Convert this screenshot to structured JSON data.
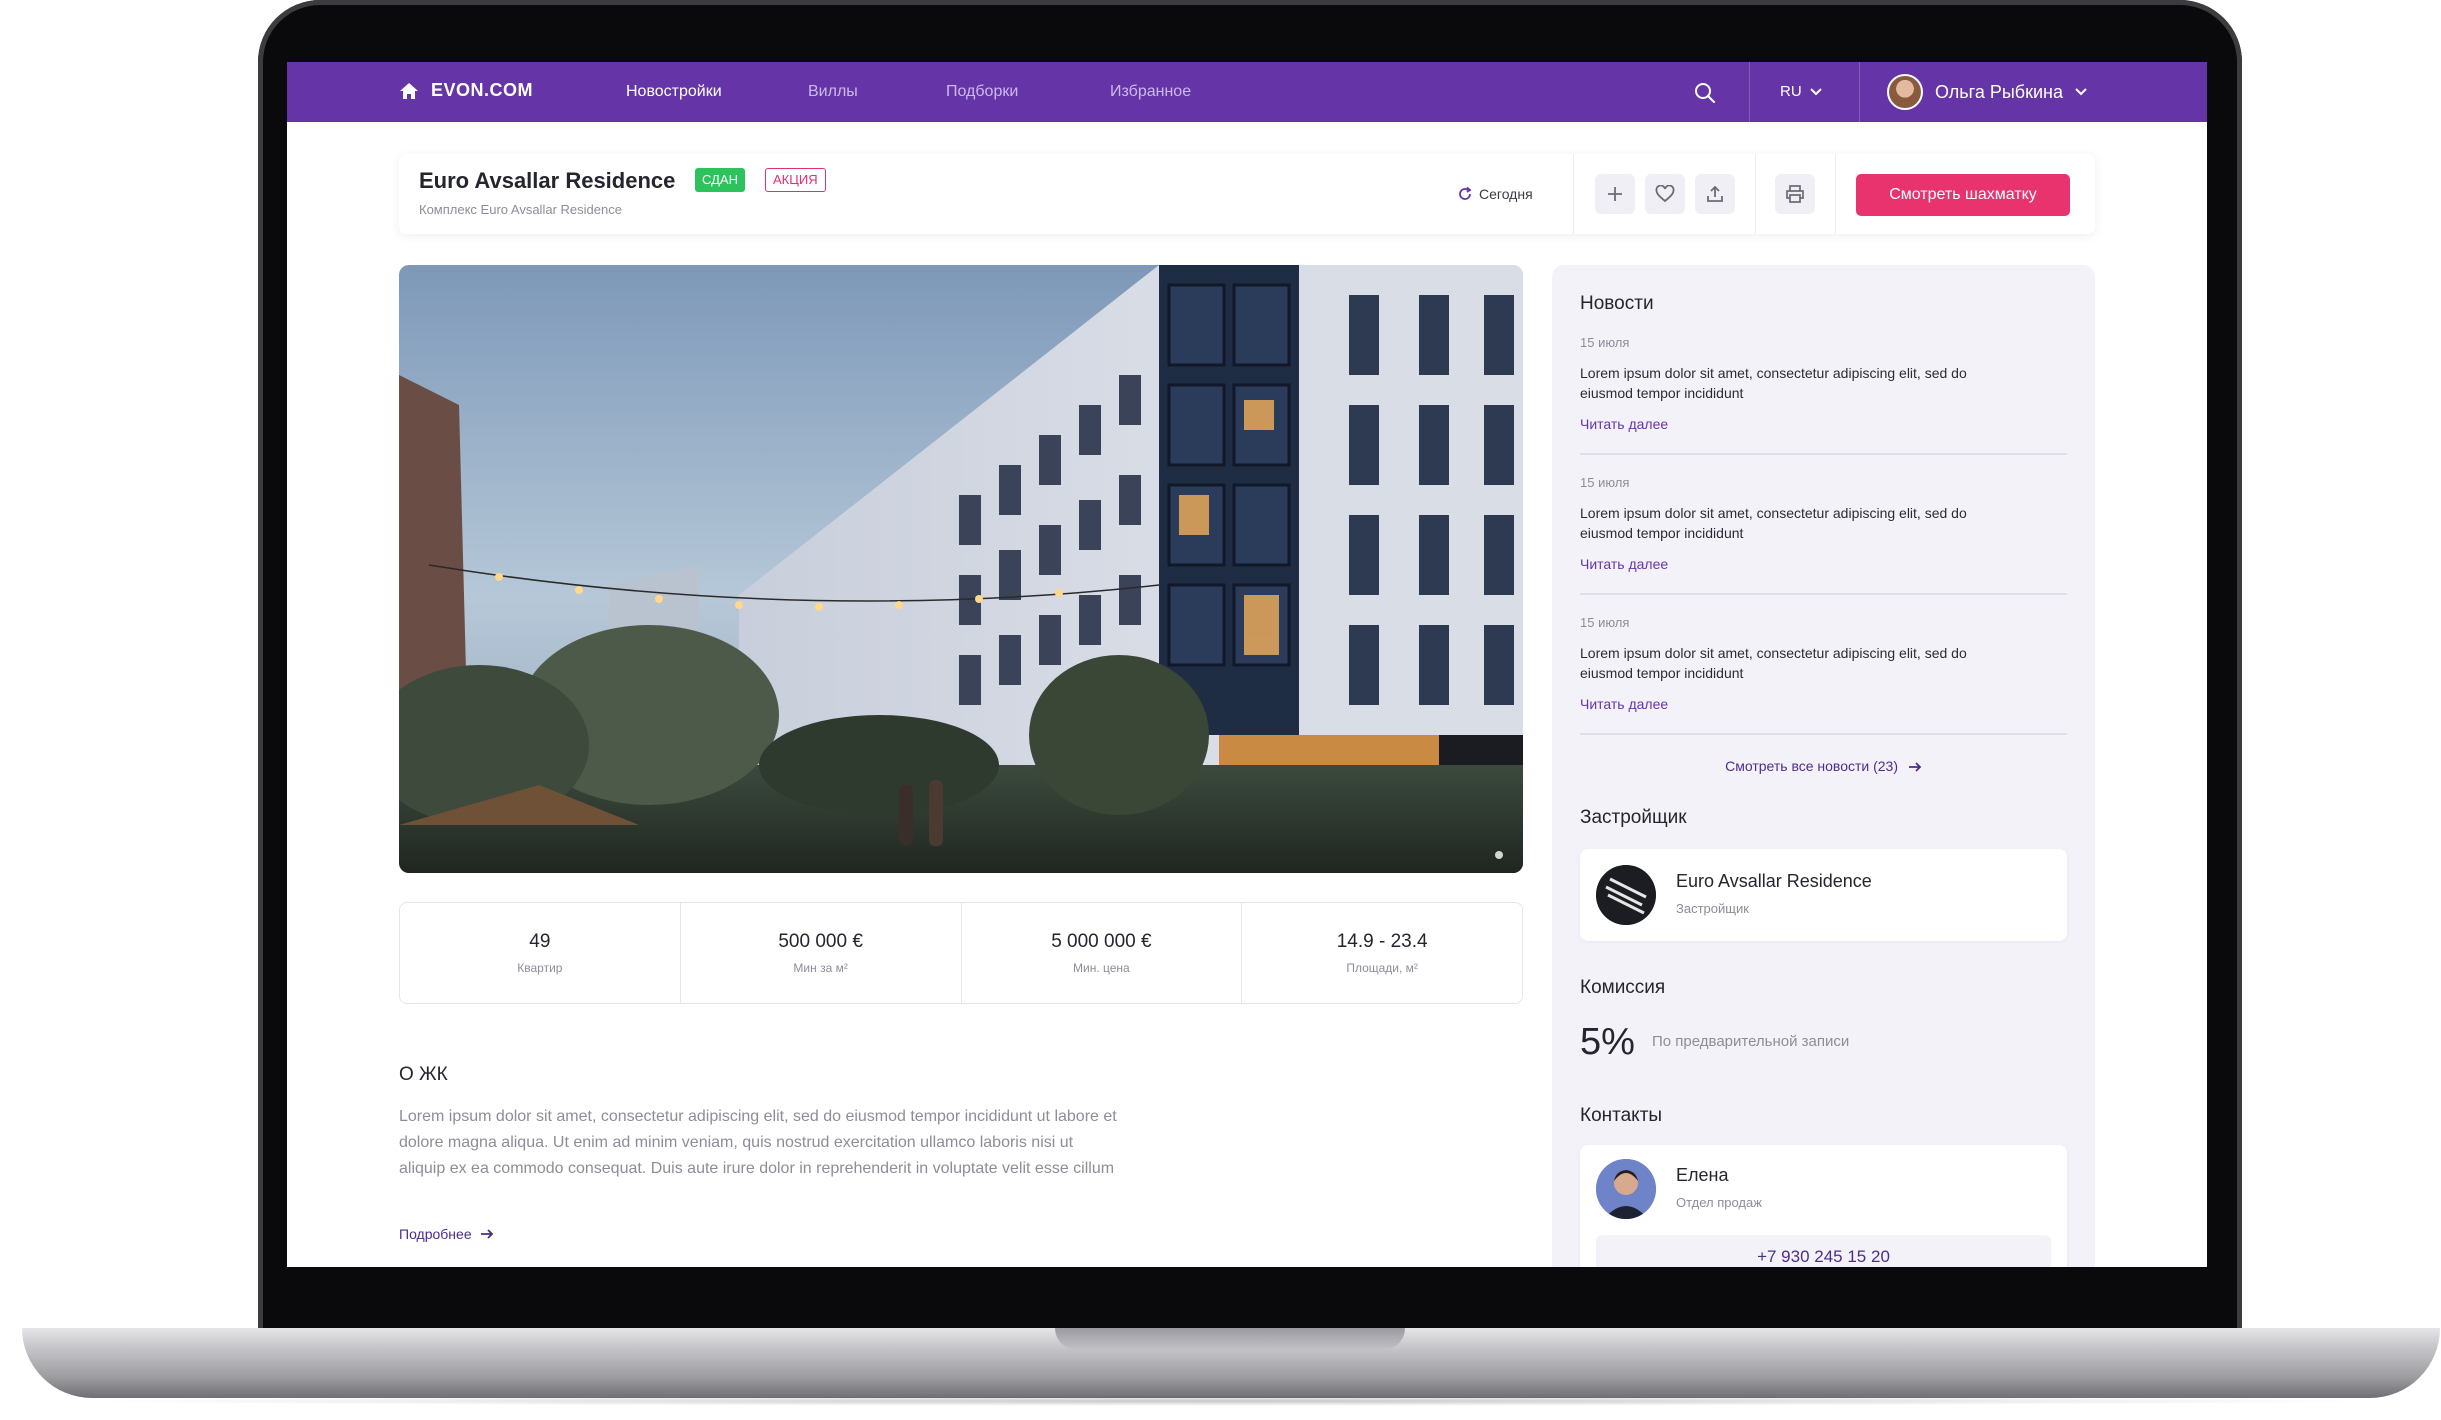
{
  "header": {
    "logo_text": "EVON.COM",
    "nav": [
      "Новостройки",
      "Виллы",
      "Подборки",
      "Избранное"
    ],
    "language": "RU",
    "user_name": "Ольга Рыбкина"
  },
  "complex": {
    "title": "Euro Avsallar Residence",
    "badge_status": "СДАН",
    "badge_promo": "АКЦИЯ",
    "subtitle": "Комплекс Euro Avsallar Residence",
    "updated": "Сегодня",
    "cta_label": "Смотреть шахматку"
  },
  "stats": [
    {
      "value": "49",
      "label": "Квартир"
    },
    {
      "value": "500 000 €",
      "label": "Мин за м²"
    },
    {
      "value": "5 000 000 €",
      "label": "Мин. цена"
    },
    {
      "value": "14.9 - 23.4",
      "label": "Площади, м²"
    }
  ],
  "about": {
    "title": "О ЖК",
    "text": "Lorem ipsum dolor sit amet, consectetur adipiscing elit, sed do eiusmod tempor incididunt ut labore et dolore magna aliqua. Ut enim ad minim veniam, quis nostrud exercitation ullamco laboris nisi ut aliquip ex ea commodo consequat. Duis aute irure dolor in reprehenderit in voluptate velit esse cillum",
    "more_label": "Подробнее"
  },
  "news": {
    "title": "Новости",
    "items": [
      {
        "date": "15 июля",
        "text": "Lorem ipsum dolor sit amet, consectetur adipiscing elit, sed do eiusmod tempor incididunt",
        "link": "Читать далее"
      },
      {
        "date": "15 июля",
        "text": "Lorem ipsum dolor sit amet, consectetur adipiscing elit, sed do eiusmod tempor incididunt",
        "link": "Читать далее"
      },
      {
        "date": "15 июля",
        "text": "Lorem ipsum dolor sit amet, consectetur adipiscing elit, sed do eiusmod tempor incididunt",
        "link": "Читать далее"
      }
    ],
    "all_label": "Смотреть все новости (23)"
  },
  "developer": {
    "title": "Застройщик",
    "name": "Euro Avsallar Residence",
    "role": "Застройщик"
  },
  "commission": {
    "title": "Комиссия",
    "value": "5%",
    "note": "По предварительной записи"
  },
  "contacts": {
    "title": "Контакты",
    "name": "Елена",
    "role": "Отдел продаж",
    "phone": "+7 930 245 15 20"
  },
  "colors": {
    "brand": "#6535a8",
    "accent": "#e8336f",
    "success": "#2ec25c"
  }
}
